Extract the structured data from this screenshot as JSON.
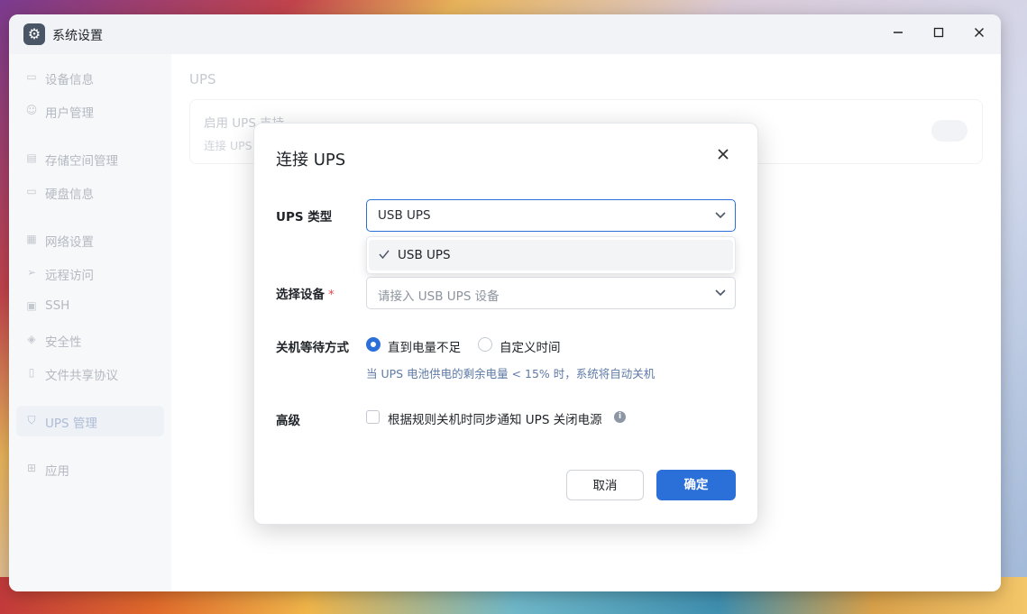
{
  "window": {
    "title": "系统设置",
    "app_icon": "gear-icon",
    "controls": [
      "minimize-icon",
      "maximize-icon",
      "close-icon"
    ]
  },
  "sidebar": {
    "items": [
      {
        "label": "设备信息",
        "icon": "monitor-icon"
      },
      {
        "label": "用户管理",
        "icon": "user-icon"
      },
      {
        "label": "存储空间管理",
        "icon": "storage-icon"
      },
      {
        "label": "硬盘信息",
        "icon": "disk-icon"
      },
      {
        "label": "网络设置",
        "icon": "network-icon"
      },
      {
        "label": "远程访问",
        "icon": "send-icon"
      },
      {
        "label": "SSH",
        "icon": "terminal-icon"
      },
      {
        "label": "安全性",
        "icon": "shield-check-icon"
      },
      {
        "label": "文件共享协议",
        "icon": "file-icon"
      },
      {
        "label": "UPS 管理",
        "icon": "shield-icon",
        "active": true
      },
      {
        "label": "应用",
        "icon": "apps-grid-icon"
      }
    ]
  },
  "main": {
    "title": "UPS",
    "card": {
      "title": "启用 UPS 支持",
      "subtitle": "连接 UPS"
    }
  },
  "dialog": {
    "title": "连接 UPS",
    "ups_type": {
      "label": "UPS 类型",
      "value": "USB UPS",
      "options": [
        "USB UPS"
      ]
    },
    "device": {
      "label": "选择设备",
      "required_mark": "*",
      "placeholder": "请接入 USB UPS 设备"
    },
    "shutdown": {
      "label": "关机等待方式",
      "options": [
        {
          "label": "直到电量不足",
          "selected": true
        },
        {
          "label": "自定义时间",
          "selected": false
        }
      ],
      "hint": "当 UPS 电池供电的剩余电量 < 15% 时，系统将自动关机"
    },
    "advanced": {
      "label": "高级",
      "checkbox_label": "根据规则关机时同步通知 UPS 关闭电源",
      "checked": false
    },
    "buttons": {
      "cancel": "取消",
      "confirm": "确定"
    }
  },
  "colors": {
    "accent": "#2b6fd8",
    "required": "#e5484d",
    "hint": "#5e7aa6"
  }
}
